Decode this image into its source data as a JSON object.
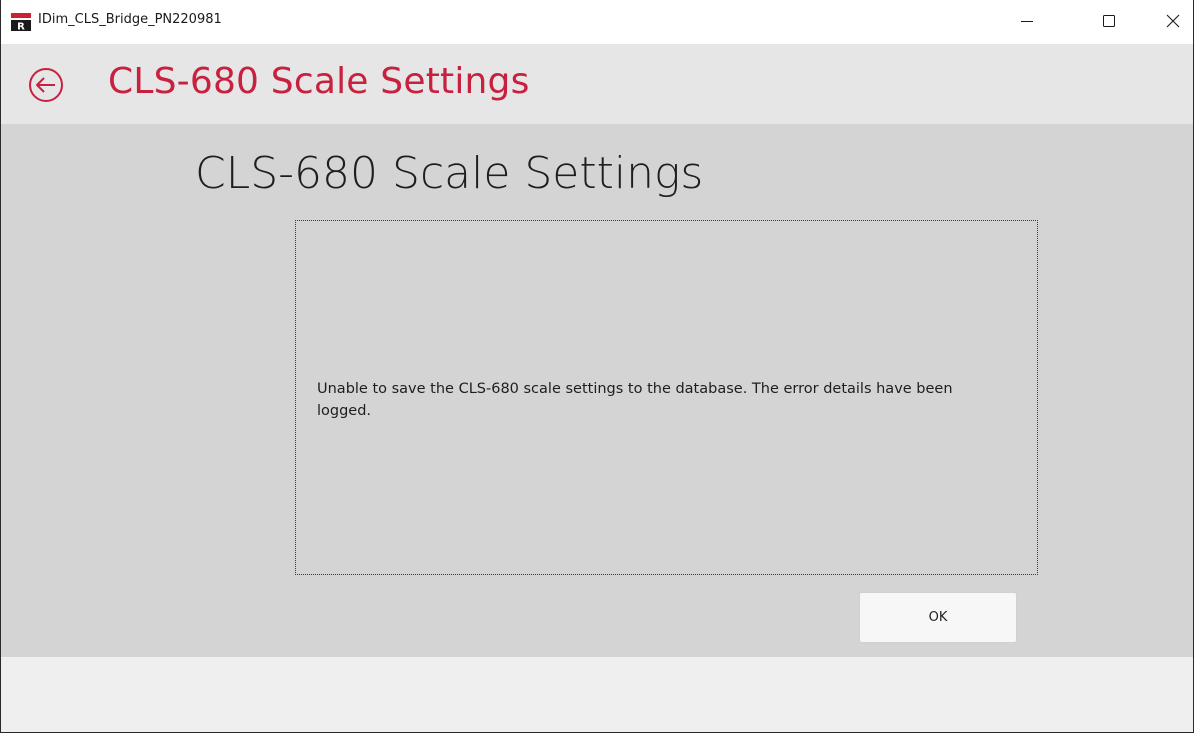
{
  "window": {
    "title": "IDim_CLS_Bridge_PN220981",
    "controls": {
      "minimize_icon": "minimize-icon",
      "maximize_icon": "maximize-icon",
      "close_icon": "close-icon"
    }
  },
  "header": {
    "back_icon": "back-arrow-icon",
    "title": "CLS-680 Scale Settings",
    "title_color": "#c8213f"
  },
  "main": {
    "page_title": "CLS-680 Scale Settings",
    "message": "Unable to save the CLS-680 scale settings to the database. The error details have been logged.",
    "ok_label": "OK"
  }
}
